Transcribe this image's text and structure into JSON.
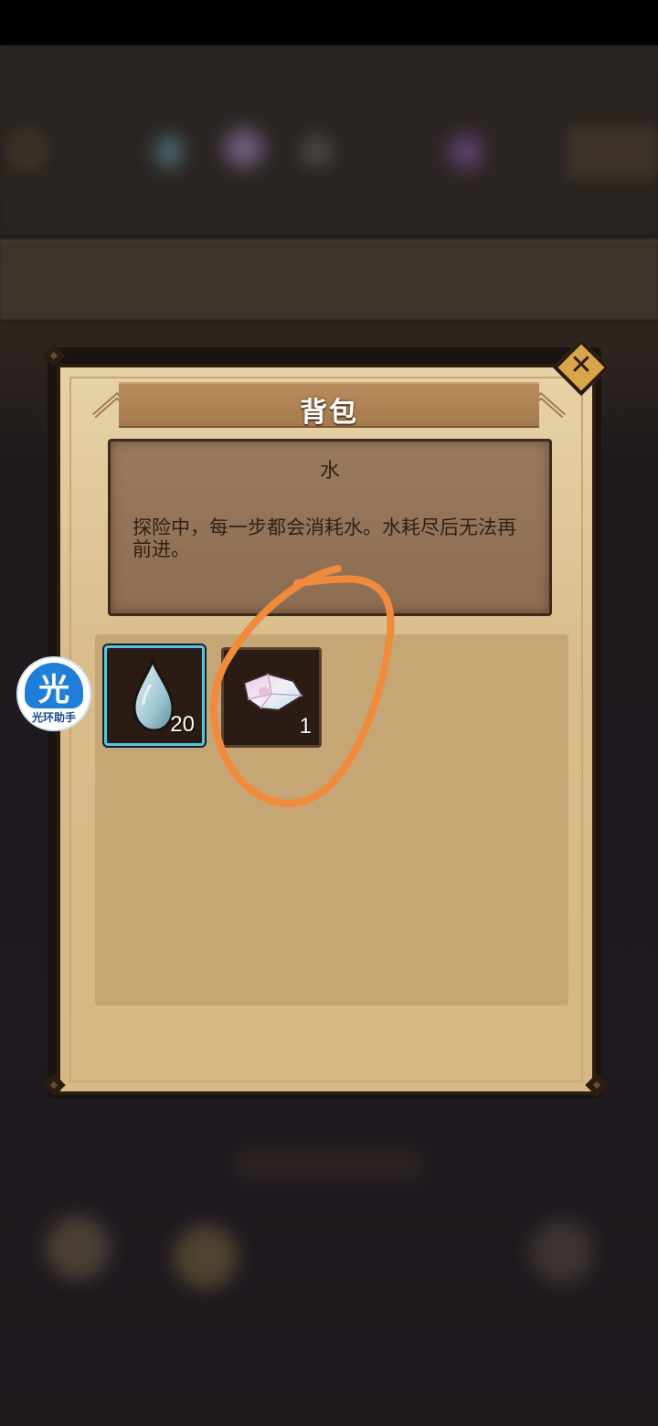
{
  "dialog": {
    "title": "背包",
    "close_symbol": "✕",
    "selected_item": {
      "name": "水",
      "description": "探险中，每一步都会消耗水。水耗尽后无法再前进。"
    },
    "items": [
      {
        "icon": "water-drop-icon",
        "count": "20",
        "selected": true
      },
      {
        "icon": "crystal-shard-icon",
        "count": "1",
        "selected": false
      }
    ]
  },
  "helper_badge": {
    "char": "光",
    "label": "光环助手"
  },
  "colors": {
    "selected_border": "#4fc8e8",
    "annotation": "#f08a3c",
    "panel": "#d9bd8c"
  }
}
